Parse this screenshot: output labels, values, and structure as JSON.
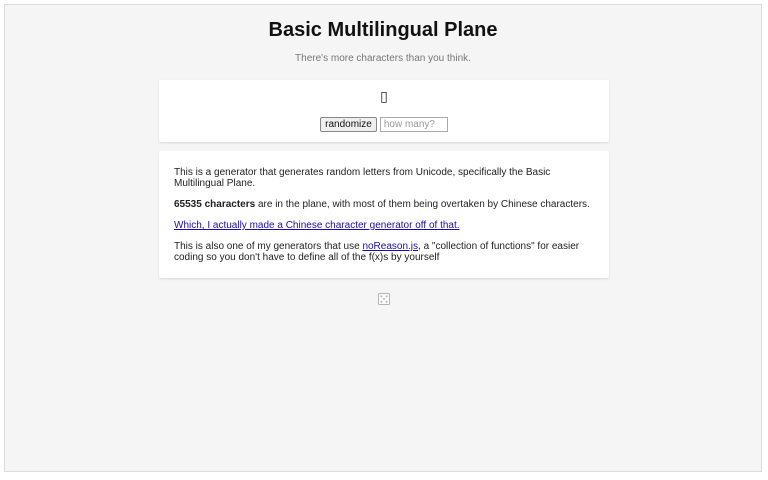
{
  "header": {
    "title": "Basic Multilingual Plane",
    "subtitle": "There's more characters than you think."
  },
  "generator": {
    "output_glyph": "▯",
    "randomize_label": "randomize",
    "count_placeholder": "how many?"
  },
  "info": {
    "p1": "This is a generator that generates random letters from Unicode, specifically the Basic Multilingual Plane.",
    "p2_bold": "65535 characters",
    "p2_rest": " are in the plane, with most of them being overtaken by Chinese characters.",
    "p3_link": "Which, I actually made a Chinese character generator off of that.",
    "p4_pre": "This is also one of my generators that use ",
    "p4_link": "noReason.js",
    "p4_post": ", a \"collection of functions\" for easier coding so you don't have to define all of the f(x)s by yourself"
  },
  "footer": {
    "icon": "dice-icon"
  },
  "colors": {
    "background": "#f5f5f5",
    "card": "#ffffff",
    "link": "#1a0dab"
  }
}
